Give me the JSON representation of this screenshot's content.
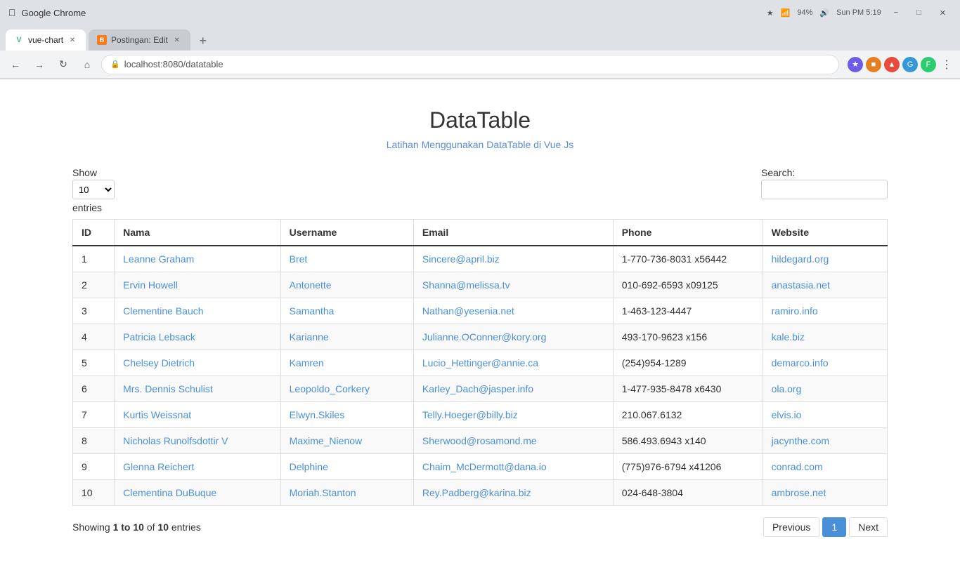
{
  "browser": {
    "tabs": [
      {
        "id": "tab1",
        "favicon_type": "vue",
        "favicon_label": "V",
        "title": "vue-chart",
        "active": true
      },
      {
        "id": "tab2",
        "favicon_type": "blogger",
        "favicon_label": "B",
        "title": "Postingan: Edit",
        "active": false
      }
    ],
    "address": "localhost:8080/datatable",
    "new_tab_label": "+"
  },
  "page": {
    "title": "DataTable",
    "subtitle": "Latihan Menggunakan DataTable di Vue Js"
  },
  "controls": {
    "show_label": "Show",
    "show_value": "10",
    "entries_label": "entries",
    "search_label": "Search:",
    "search_placeholder": ""
  },
  "table": {
    "columns": [
      {
        "key": "id",
        "label": "ID"
      },
      {
        "key": "nama",
        "label": "Nama"
      },
      {
        "key": "username",
        "label": "Username"
      },
      {
        "key": "email",
        "label": "Email"
      },
      {
        "key": "phone",
        "label": "Phone"
      },
      {
        "key": "website",
        "label": "Website"
      }
    ],
    "rows": [
      {
        "id": "1",
        "nama": "Leanne Graham",
        "username": "Bret",
        "email": "Sincere@april.biz",
        "phone": "1-770-736-8031 x56442",
        "website": "hildegard.org"
      },
      {
        "id": "2",
        "nama": "Ervin Howell",
        "username": "Antonette",
        "email": "Shanna@melissa.tv",
        "phone": "010-692-6593 x09125",
        "website": "anastasia.net"
      },
      {
        "id": "3",
        "nama": "Clementine Bauch",
        "username": "Samantha",
        "email": "Nathan@yesenia.net",
        "phone": "1-463-123-4447",
        "website": "ramiro.info"
      },
      {
        "id": "4",
        "nama": "Patricia Lebsack",
        "username": "Karianne",
        "email": "Julianne.OConner@kory.org",
        "phone": "493-170-9623 x156",
        "website": "kale.biz"
      },
      {
        "id": "5",
        "nama": "Chelsey Dietrich",
        "username": "Kamren",
        "email": "Lucio_Hettinger@annie.ca",
        "phone": "(254)954-1289",
        "website": "demarco.info"
      },
      {
        "id": "6",
        "nama": "Mrs. Dennis Schulist",
        "username": "Leopoldo_Corkery",
        "email": "Karley_Dach@jasper.info",
        "phone": "1-477-935-8478 x6430",
        "website": "ola.org"
      },
      {
        "id": "7",
        "nama": "Kurtis Weissnat",
        "username": "Elwyn.Skiles",
        "email": "Telly.Hoeger@billy.biz",
        "phone": "210.067.6132",
        "website": "elvis.io"
      },
      {
        "id": "8",
        "nama": "Nicholas Runolfsdottir V",
        "username": "Maxime_Nienow",
        "email": "Sherwood@rosamond.me",
        "phone": "586.493.6943 x140",
        "website": "jacynthe.com"
      },
      {
        "id": "9",
        "nama": "Glenna Reichert",
        "username": "Delphine",
        "email": "Chaim_McDermott@dana.io",
        "phone": "(775)976-6794 x41206",
        "website": "conrad.com"
      },
      {
        "id": "10",
        "nama": "Clementina DuBuque",
        "username": "Moriah.Stanton",
        "email": "Rey.Padberg@karina.biz",
        "phone": "024-648-3804",
        "website": "ambrose.net"
      }
    ]
  },
  "pagination": {
    "showing_prefix": "Showing ",
    "showing_range": "1 to 10",
    "showing_middle": " of ",
    "showing_total": "10",
    "showing_suffix": " entries",
    "previous_label": "Previous",
    "next_label": "Next",
    "current_page": "1"
  }
}
